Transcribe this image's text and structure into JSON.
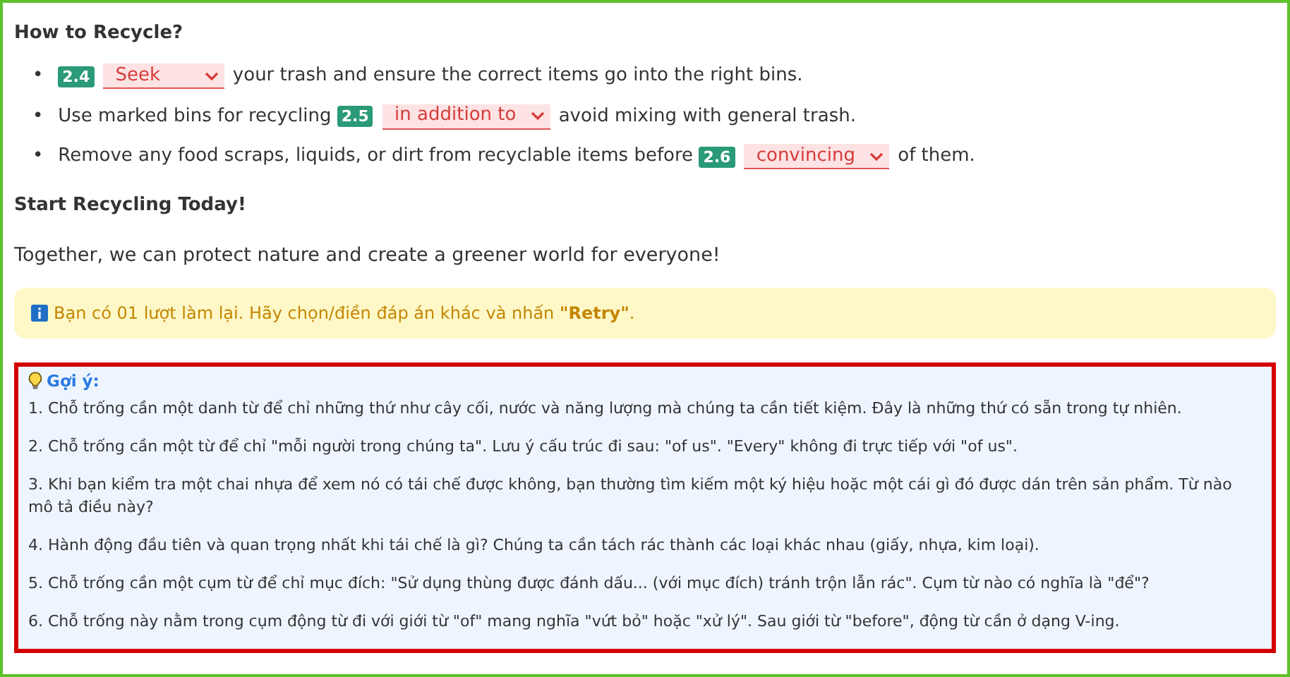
{
  "section_title": "How to Recycle?",
  "bullet": "•",
  "items": [
    {
      "number": "2.4",
      "answer": "Seek",
      "correct": false,
      "after": "your trash and ensure the correct items go into the right bins."
    },
    {
      "before": "Use marked bins for recycling",
      "number": "2.5",
      "answer": "in addition to",
      "correct": false,
      "after": "avoid mixing with general trash."
    },
    {
      "before": "Remove any food scraps, liquids, or dirt from recyclable items before",
      "number": "2.6",
      "answer": "convincing",
      "correct": false,
      "after": "of them."
    }
  ],
  "closing_title": "Start Recycling Today!",
  "closing_text": "Together, we can protect nature and create a greener world for everyone!",
  "notice": "Bạn có 01 lượt làm lại. Hãy chọn/điền đáp án khác và nhấn **\"Retry\"**.",
  "hints": {
    "title": "Gợi ý:",
    "items": [
      "1. Chỗ trống cần một danh từ để chỉ những thứ như cây cối, nước và năng lượng mà chúng ta cần tiết kiệm. Đây là những thứ có sẵn trong tự nhiên.",
      "2. Chỗ trống cần một từ để chỉ \"mỗi người trong chúng ta\". Lưu ý cấu trúc đi sau: \"of us\". \"Every\" không đi trực tiếp với \"of us\".",
      "3. Khi bạn kiểm tra một chai nhựa để xem nó có tái chế được không, bạn thường tìm kiếm một ký hiệu hoặc một cái gì đó được dán trên sản phẩm. Từ nào mô tả điều này?",
      "4. Hành động đầu tiên và quan trọng nhất khi tái chế là gì? Chúng ta cần tách rác thành các loại khác nhau (giấy, nhựa, kim loại).",
      "5. Chỗ trống cần một cụm từ để chỉ mục đích: \"Sử dụng thùng được đánh dấu... (với mục đích) tránh trộn lẫn rác\". Cụm từ nào có nghĩa là \"để\"?",
      "6. Chỗ trống này nằm trong cụm động từ đi với giới từ \"of\" mang nghĩa \"vứt bỏ\" hoặc \"xử lý\". Sau giới từ \"before\", động từ cần ở dạng V-ing."
    ]
  }
}
